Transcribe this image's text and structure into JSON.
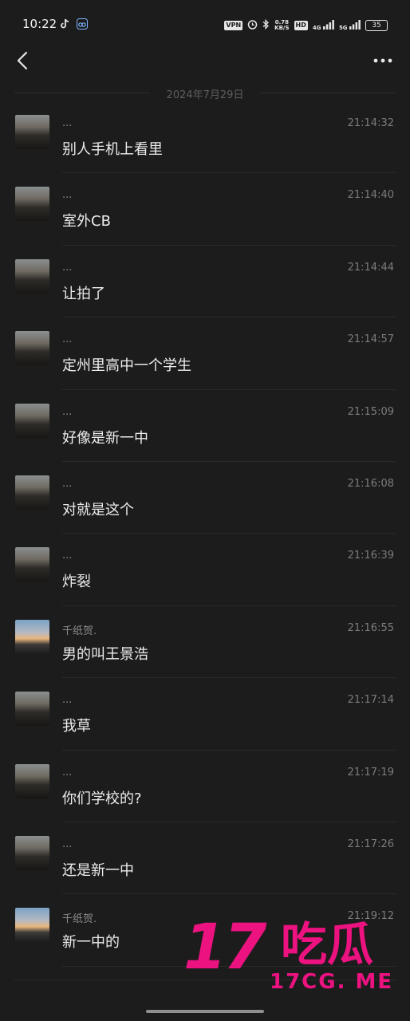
{
  "status_bar": {
    "time": "10:22",
    "left_icons": [
      "tiktok-icon",
      "link-icon"
    ],
    "vpn": "VPN",
    "speed_value": "0.78",
    "speed_unit": "KB/S",
    "hd": "HD",
    "network_a": "4G",
    "network_b": "5G",
    "battery": "35"
  },
  "header": {
    "back_icon": "chevron-left-icon",
    "more_icon": "more-dots-icon"
  },
  "date_separator": "2024年7月29日",
  "messages": [
    {
      "sender": "...",
      "time": "21:14:32",
      "text": "别人手机上看里",
      "avatar": "city"
    },
    {
      "sender": "...",
      "time": "21:14:40",
      "text": "室外CB",
      "avatar": "city"
    },
    {
      "sender": "...",
      "time": "21:14:44",
      "text": "让拍了",
      "avatar": "city"
    },
    {
      "sender": "...",
      "time": "21:14:57",
      "text": "定州里高中一个学生",
      "avatar": "city"
    },
    {
      "sender": "...",
      "time": "21:15:09",
      "text": "好像是新一中",
      "avatar": "city"
    },
    {
      "sender": "...",
      "time": "21:16:08",
      "text": "对就是这个",
      "avatar": "city"
    },
    {
      "sender": "...",
      "time": "21:16:39",
      "text": "炸裂",
      "avatar": "city"
    },
    {
      "sender": "千纸贺.",
      "time": "21:16:55",
      "text": "男的叫王景浩",
      "avatar": "sunset"
    },
    {
      "sender": "...",
      "time": "21:17:14",
      "text": "我草",
      "avatar": "city"
    },
    {
      "sender": "...",
      "time": "21:17:19",
      "text": "你们学校的?",
      "avatar": "city"
    },
    {
      "sender": "...",
      "time": "21:17:26",
      "text": "还是新一中",
      "avatar": "city"
    },
    {
      "sender": "千纸贺.",
      "time": "21:19:12",
      "text": "新一中的",
      "avatar": "sunset"
    }
  ],
  "watermark": {
    "big": "17",
    "cn": "吃瓜",
    "small": "17CG. ME"
  },
  "colors": {
    "background": "#1c1c1c",
    "watermark": "#ec1280"
  }
}
